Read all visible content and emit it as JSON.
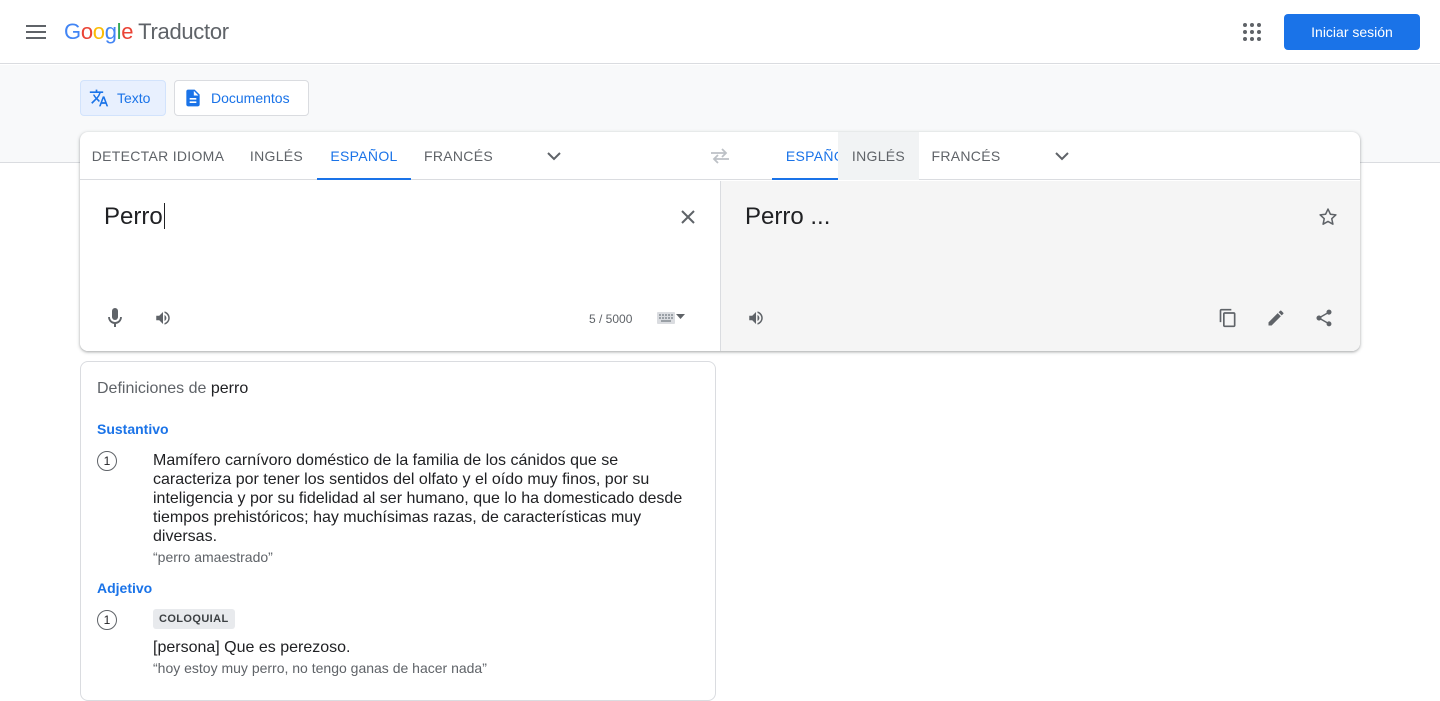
{
  "header": {
    "logo_letters": [
      "G",
      "o",
      "o",
      "g",
      "l",
      "e"
    ],
    "product": "Traductor",
    "signin_label": "Iniciar sesión"
  },
  "modes": [
    {
      "label": "Texto",
      "icon": "translate-icon",
      "active": true
    },
    {
      "label": "Documentos",
      "icon": "document-icon",
      "active": false
    }
  ],
  "source_langs": {
    "tabs": [
      "DETECTAR IDIOMA",
      "INGLÉS",
      "ESPAÑOL",
      "FRANCÉS"
    ],
    "selected": "ESPAÑOL"
  },
  "target_langs": {
    "tabs": [
      "ESPAÑOL",
      "INGLÉS",
      "FRANCÉS"
    ],
    "selected": "ESPAÑOL"
  },
  "source": {
    "text": "Perro",
    "char_count": "5 / 5000"
  },
  "target": {
    "text": "Perro ..."
  },
  "definitions": {
    "title_prefix": "Definiciones de",
    "word": "perro",
    "sections": [
      {
        "pos": "Sustantivo",
        "items": [
          {
            "num": "1",
            "text": "Mamífero carnívoro doméstico de la familia de los cánidos que se caracteriza por tener los sentidos del olfato y el oído muy finos, por su inteligencia y por su fidelidad al ser humano, que lo ha domesticado desde tiempos prehistóricos; hay muchísimas razas, de características muy diversas.",
            "example": "“perro amaestrado”"
          }
        ]
      },
      {
        "pos": "Adjetivo",
        "items": [
          {
            "num": "1",
            "tag": "COLOQUIAL",
            "text": "[persona] Que es perezoso.",
            "example": "“hoy estoy muy perro, no tengo ganas de hacer nada”"
          }
        ]
      }
    ]
  },
  "colors": {
    "accent": "#1a73e8",
    "target_bg": "#f5f5f5",
    "band_bg": "#f8f9fa"
  }
}
